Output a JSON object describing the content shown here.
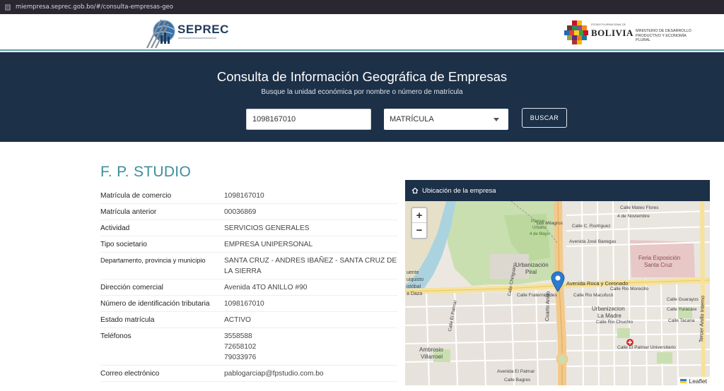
{
  "browser": {
    "url": "miempresa.seprec.gob.bo/#/consulta-empresas-geo"
  },
  "header": {
    "seprec_logo_text": "SEPREC",
    "bolivia_small": "ESTADO PLURINACIONAL DE",
    "bolivia_name": "BOLIVIA",
    "ministry_line1": "MINISTERIO DE DESARROLLO",
    "ministry_line2": "PRODUCTIVO Y ECONOMÍA PLURAL"
  },
  "search": {
    "title": "Consulta de Información Geográfica de Empresas",
    "subtitle": "Busque la unidad económica por nombre o número de matrícula",
    "query_value": "1098167010",
    "type_selected": "MATRÍCULA",
    "button_label": "BUSCAR"
  },
  "company": {
    "name": "F. P. STUDIO",
    "fields": [
      {
        "label": "Matrícula de comercio",
        "value": "1098167010"
      },
      {
        "label": "Matrícula anterior",
        "value": "00036869"
      },
      {
        "label": "Actividad",
        "value": "SERVICIOS GENERALES"
      },
      {
        "label": "Tipo societario",
        "value": "EMPRESA UNIPERSONAL"
      },
      {
        "label": "Departamento, provincia y municipio",
        "value": "SANTA CRUZ - ANDRES IBAÑEZ - SANTA CRUZ DE LA SIERRA"
      },
      {
        "label": "Dirección comercial",
        "value": "Avenida 4TO ANILLO #90"
      },
      {
        "label": "Número de identificación tributaria",
        "value": "1098167010"
      },
      {
        "label": "Estado matrícula",
        "value": "ACTIVO"
      },
      {
        "label": "Teléfonos",
        "value": "3558588\n72658102\n79033976"
      },
      {
        "label": "Correo electrónico",
        "value": "pablogarciap@fpstudio.com.bo"
      }
    ]
  },
  "map": {
    "title": "Ubicación de la empresa",
    "zoom_in": "+",
    "zoom_out": "−",
    "attribution": "Leaflet",
    "labels": {
      "los_milagros": "Los Milagros",
      "parque": "Parque",
      "urbano": "Urbano",
      "mayo": "4 de Mayo",
      "urbanizacion_piral_1": "Urbanización",
      "urbanizacion_piral_2": "Piral",
      "av_roca": "Avenida Roca y Coronado",
      "feria_1": "Feria Exposición",
      "feria_2": "Santa Cruz",
      "urb_madre_1": "Urbanizacion",
      "urb_madre_2": "La Madre",
      "cuarto_anillo": "Cuarto Anillo",
      "tercer_anillo": "Tercer Anillo Interno",
      "ambrosio_1": "Ambrosio",
      "ambrosio_2": "Villarroel",
      "el_palmar": "Avenida El Palmar",
      "el_palmar_univ": "Calle El Palmar Universitario",
      "jose_banegas": "Avenida José Banegas",
      "cuarto_dn": "4 de Noviembre",
      "mateo_flores": "Calle Mateo Flores",
      "c_rodriguez": "Calle C. Rodriguez",
      "rio_macufuco": "Calle Rio Macufucó",
      "rio_morecillo": "Calle Rio Morecillo",
      "calle_uruguay": "Calle Yuracare",
      "calle_tacana": "Calle Tacana",
      "calle_guarayos": "Calle Guarayos",
      "calle_chiriguano": "Calle Chiriguano",
      "fraternidades": "Calle Fraternidades",
      "calle_rio_chuchio": "Calle Rio Chuchio",
      "calle_ayacucho": "Calle Ayacucho",
      "cuente": "uente",
      "uiquisto": "uiquisto",
      "cristobal": "istóbal",
      "la_daza": "a Daza",
      "calle_bagres": "Calle Bagres",
      "calle_palmar2": "Calle El Palmar"
    }
  },
  "colors": {
    "banner": "#1c3048",
    "accent": "#3b8e9c",
    "marker": "#2b7bd0"
  }
}
